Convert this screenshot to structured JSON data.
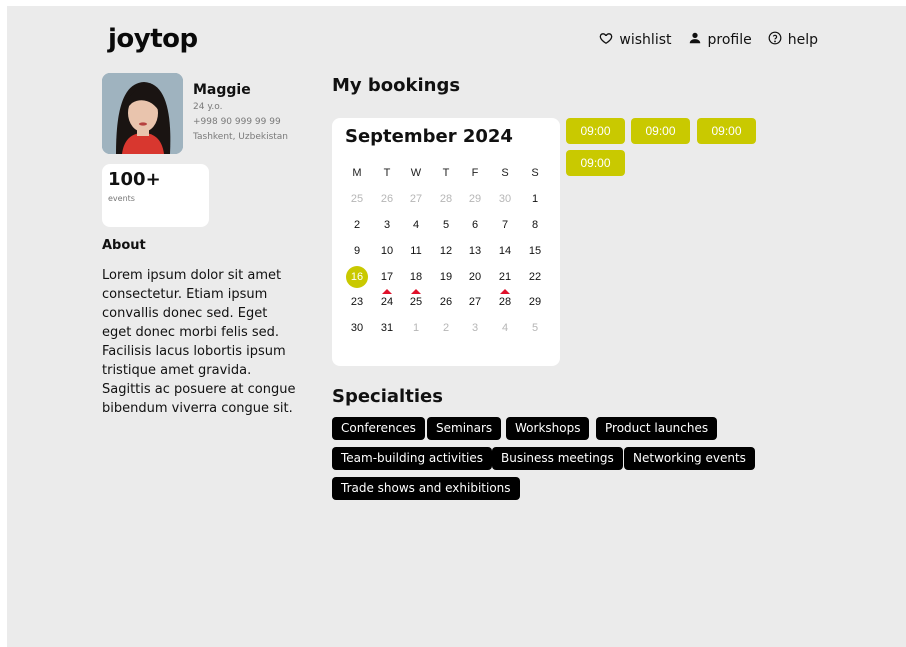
{
  "header": {
    "logo": "joytop",
    "nav": [
      {
        "label": "wishlist",
        "icon": "heart-icon"
      },
      {
        "label": "profile",
        "icon": "user-icon"
      },
      {
        "label": "help",
        "icon": "help-circle-icon"
      }
    ]
  },
  "profile": {
    "name": "Maggie",
    "age": "24 y.o.",
    "phone": "+998 90 999 99 99",
    "location": "Tashkent, Uzbekistan",
    "stat_value": "100+",
    "stat_label": "events",
    "about_title": "About",
    "about_text": "Lorem ipsum dolor sit amet consectetur. Etiam ipsum convallis donec sed. Eget eget donec morbi felis sed. Facilisis lacus lobortis ipsum tristique amet gravida. Sagittis ac posuere at congue bibendum viverra congue sit."
  },
  "bookings": {
    "title": "My bookings",
    "calendar": {
      "month": "September 2024",
      "weekdays": [
        "M",
        "T",
        "W",
        "T",
        "F",
        "S",
        "S"
      ],
      "weeks": [
        [
          "25",
          "26",
          "27",
          "28",
          "29",
          "30",
          "1"
        ],
        [
          "2",
          "3",
          "4",
          "5",
          "6",
          "7",
          "8"
        ],
        [
          "9",
          "10",
          "11",
          "12",
          "13",
          "14",
          "15"
        ],
        [
          "16",
          "17",
          "18",
          "19",
          "20",
          "21",
          "22"
        ],
        [
          "23",
          "24",
          "25",
          "26",
          "27",
          "28",
          "29"
        ],
        [
          "30",
          "31",
          "1",
          "2",
          "3",
          "4",
          "5"
        ]
      ],
      "selected": "16",
      "event_days": [
        "24",
        "25",
        "28"
      ]
    },
    "slots": [
      "09:00",
      "09:00",
      "09:00",
      "09:00"
    ]
  },
  "specialties": {
    "title": "Specialties",
    "tags": [
      "Conferences",
      "Seminars",
      "Workshops",
      "Product launches",
      "Team-building activities",
      "Business meetings",
      "Networking events",
      "Trade shows and exhibitions"
    ]
  },
  "colors": {
    "accent": "#c9c900",
    "event_marker": "#e0102a",
    "background": "#ebebeb",
    "tag_bg": "#000000"
  }
}
